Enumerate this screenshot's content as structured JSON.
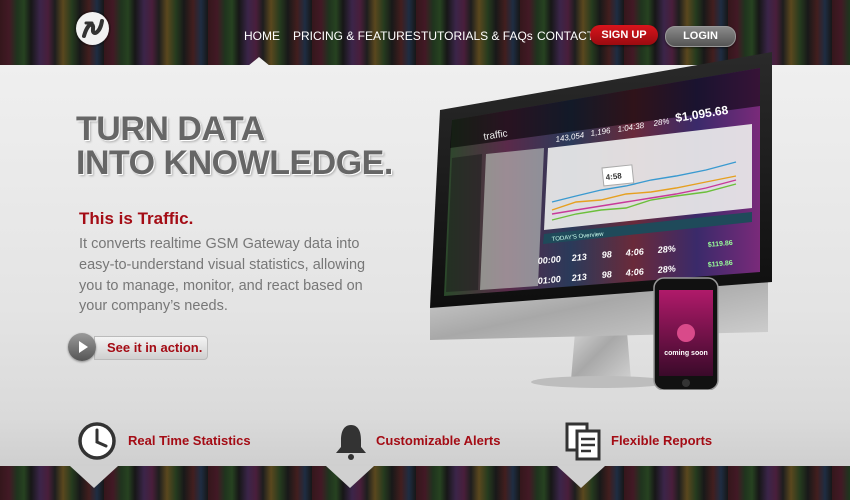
{
  "nav": {
    "logo_icon": "traffic-swirl-logo",
    "links": [
      {
        "label": "HOME",
        "active": true
      },
      {
        "label": "PRICING & FEATURES"
      },
      {
        "label": "TUTORIALS & FAQs"
      },
      {
        "label": "CONTACT"
      }
    ],
    "signup_label": "SIGN UP",
    "login_label": "LOGIN"
  },
  "hero": {
    "headline_line1": "TURN DATA",
    "headline_line2": "INTO KNOWLEDGE.",
    "subhead": "This is Traffic.",
    "body": "It converts realtime GSM Gateway data into easy-to-understand visual statistics, allowing you to manage, monitor, and react based on your company’s needs.",
    "cta_label": "See it in action.",
    "cta_icon": "play-icon"
  },
  "screen": {
    "app_name": "traffic",
    "stats": [
      "143,054",
      "1,196",
      "1:04:38",
      "28%"
    ],
    "balance": "$1,095.68",
    "overview_label": "TODAY'S Overview",
    "rows": [
      {
        "time": "00:00",
        "a": "213",
        "b": "98",
        "c": "4:06",
        "d": "28%",
        "money": "$119.86"
      },
      {
        "time": "01:00",
        "a": "213",
        "b": "98",
        "c": "4:06",
        "d": "28%",
        "money": "$119.86"
      }
    ],
    "tooltip": "4:58"
  },
  "phone": {
    "label": "coming soon"
  },
  "features": [
    {
      "label": "Real Time Statistics",
      "icon": "clock-icon"
    },
    {
      "label": "Customizable Alerts",
      "icon": "bell-icon"
    },
    {
      "label": "Flexible Reports",
      "icon": "reports-icon"
    }
  ],
  "colors": {
    "accent_red": "#a40c15",
    "signup_red": "#d8141c",
    "panel_gray": "#e6e6e6"
  }
}
